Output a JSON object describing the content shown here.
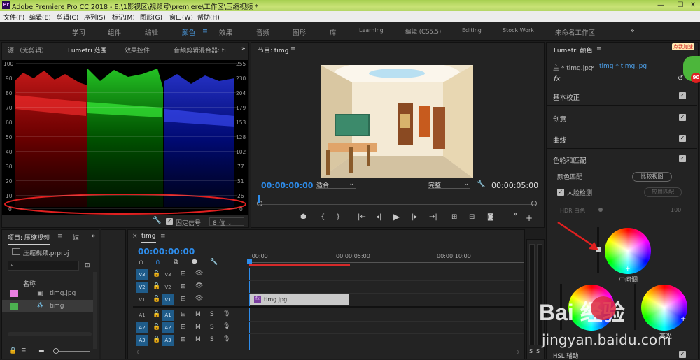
{
  "app": {
    "title": "Adobe Premiere Pro CC 2018 - E:\\1影视区\\视频号\\premiere\\工作区\\压缩视频 *",
    "logo": "Pr"
  },
  "window_controls": {
    "minimize": "—",
    "maximize": "☐",
    "close": "✕"
  },
  "menu": [
    "文件(F)",
    "编辑(E)",
    "剪辑(C)",
    "序列(S)",
    "标记(M)",
    "图形(G)",
    "窗口(W)",
    "帮助(H)"
  ],
  "workspaces": [
    "学习",
    "组件",
    "编辑",
    "颜色",
    "效果",
    "音频",
    "图形",
    "库",
    "Learning",
    "编辑 (CS5.5)",
    "Editing",
    "Stock Work",
    "未命名工作区"
  ],
  "workspaces_more": "»",
  "workspace_active_icon": "≡",
  "source_panel": {
    "tabs": [
      "源:（无剪辑）",
      "Lumetri 范围",
      "效果控件",
      "音频剪辑混合器: ti"
    ],
    "more": "»",
    "left_axis": [
      "100",
      "90",
      "80",
      "70",
      "60",
      "50",
      "40",
      "30",
      "20",
      "10",
      "0"
    ],
    "right_axis": [
      "255",
      "230",
      "204",
      "179",
      "153",
      "128",
      "102",
      "77",
      "51",
      "26",
      "0"
    ],
    "clamp_label": "固定信号",
    "bit_depth": "8 位"
  },
  "program_panel": {
    "title": "节目: timg",
    "menu_icon": "≡",
    "timecode_left": "00:00:00:00",
    "fit": "适合",
    "quality": "完整",
    "timecode_right": "00:00:05:00"
  },
  "project_panel": {
    "tab": "项目: 压缩视频",
    "tab2": "媒",
    "more": "»",
    "file": "压缩视频.prproj",
    "column_name": "名称",
    "items": [
      {
        "name": "timg.jpg",
        "color": "#e87fe0"
      },
      {
        "name": "timg",
        "color": "#4cb050"
      }
    ]
  },
  "timeline": {
    "tab": "timg",
    "close": "×",
    "menu_icon": "≡",
    "timecode": "00:00:00:00",
    "ruler": [
      ":00:00",
      "00:00:05:00",
      "00:00:10:00"
    ],
    "video_tracks": [
      {
        "target": "V3",
        "name": "V3"
      },
      {
        "target": "V2",
        "name": "V2"
      },
      {
        "target": "V1",
        "name": "V1"
      }
    ],
    "audio_tracks": [
      {
        "target": "A1",
        "name": "A1",
        "m": "M",
        "s": "S"
      },
      {
        "target": "A2",
        "name": "A2",
        "m": "M",
        "s": "S"
      },
      {
        "target": "A3",
        "name": "A3",
        "m": "M",
        "s": "S"
      }
    ],
    "clip": "timg.jpg",
    "clip_fx": "fx",
    "meter_labels": [
      "S",
      "S"
    ]
  },
  "lumetri": {
    "title": "Lumetri 颜色",
    "menu_icon": "≡",
    "master": "主 * timg.jpg",
    "clip": "timg * timg.jpg",
    "fx": "fx",
    "sections": [
      "基本校正",
      "创意",
      "曲线",
      "色轮和匹配"
    ],
    "color_match": "颜色匹配",
    "compare_view": "比较视图",
    "face_detect": "人脸检测",
    "apply_match": "应用匹配",
    "hdr_label": "HDR 白色",
    "hdr_value": "100",
    "midtone": "中间调",
    "highlight": "高光",
    "hsl": "HSL 辅助"
  },
  "overlay": {
    "badge_top": "点我加速",
    "badge_num": "90",
    "watermark_url": "jingyan.baidu.com",
    "watermark_brand": "Bai  经验"
  }
}
